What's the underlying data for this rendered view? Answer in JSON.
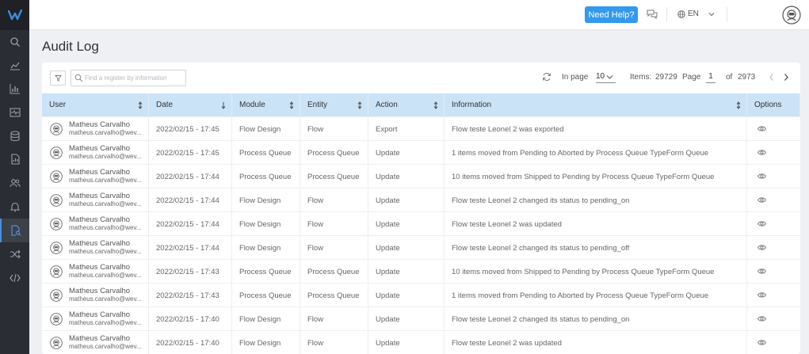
{
  "header": {
    "help_label": "Need Help?",
    "lang_label": "EN"
  },
  "page": {
    "title": "Audit Log"
  },
  "toolbar": {
    "search_placeholder": "Find a register by information",
    "in_page_label": "In page",
    "in_page_value": "10",
    "items_label": "Items:",
    "items_value": "29729",
    "page_label": "Page",
    "page_value": "1",
    "of_label": "of",
    "total_pages": "2973"
  },
  "columns": [
    "User",
    "Date",
    "Module",
    "Entity",
    "Action",
    "Information",
    "Options"
  ],
  "rows": [
    {
      "name": "Matheus Carvalho",
      "email": "matheus.carvalho@wev...",
      "date": "2022/02/15 - 17:45",
      "module": "Flow Design",
      "entity": "Flow",
      "action": "Export",
      "info": "Flow teste Leonel 2 was exported"
    },
    {
      "name": "Matheus Carvalho",
      "email": "matheus.carvalho@wev...",
      "date": "2022/02/15 - 17:45",
      "module": "Process Queue",
      "entity": "Process Queue",
      "action": "Update",
      "info": "1 items moved from Pending to Aborted by Process Queue TypeForm Queue"
    },
    {
      "name": "Matheus Carvalho",
      "email": "matheus.carvalho@wev...",
      "date": "2022/02/15 - 17:44",
      "module": "Process Queue",
      "entity": "Process Queue",
      "action": "Update",
      "info": "10 items moved from Shipped to Pending by Process Queue TypeForm Queue"
    },
    {
      "name": "Matheus Carvalho",
      "email": "matheus.carvalho@wev...",
      "date": "2022/02/15 - 17:44",
      "module": "Flow Design",
      "entity": "Flow",
      "action": "Update",
      "info": "Flow teste Leonel 2 changed its status to pending_on"
    },
    {
      "name": "Matheus Carvalho",
      "email": "matheus.carvalho@wev...",
      "date": "2022/02/15 - 17:44",
      "module": "Flow Design",
      "entity": "Flow",
      "action": "Update",
      "info": "Flow teste Leonel 2 was updated"
    },
    {
      "name": "Matheus Carvalho",
      "email": "matheus.carvalho@wev...",
      "date": "2022/02/15 - 17:44",
      "module": "Flow Design",
      "entity": "Flow",
      "action": "Update",
      "info": "Flow teste Leonel 2 changed its status to pending_off"
    },
    {
      "name": "Matheus Carvalho",
      "email": "matheus.carvalho@wev...",
      "date": "2022/02/15 - 17:43",
      "module": "Process Queue",
      "entity": "Process Queue",
      "action": "Update",
      "info": "10 items moved from Shipped to Pending by Process Queue TypeForm Queue"
    },
    {
      "name": "Matheus Carvalho",
      "email": "matheus.carvalho@wev...",
      "date": "2022/02/15 - 17:43",
      "module": "Process Queue",
      "entity": "Process Queue",
      "action": "Update",
      "info": "1 items moved from Pending to Aborted by Process Queue TypeForm Queue"
    },
    {
      "name": "Matheus Carvalho",
      "email": "matheus.carvalho@wev...",
      "date": "2022/02/15 - 17:40",
      "module": "Flow Design",
      "entity": "Flow",
      "action": "Update",
      "info": "Flow teste Leonel 2 changed its status to pending_on"
    },
    {
      "name": "Matheus Carvalho",
      "email": "matheus.carvalho@wev...",
      "date": "2022/02/15 - 17:40",
      "module": "Flow Design",
      "entity": "Flow",
      "action": "Update",
      "info": "Flow teste Leonel 2 was updated"
    }
  ],
  "sidebar": {
    "icons": [
      "search-icon",
      "trend-icon",
      "bar-chart-icon",
      "monitor-icon",
      "database-icon",
      "report-icon",
      "users-icon",
      "bell-icon",
      "audit-icon",
      "shuffle-icon",
      "code-icon"
    ],
    "active": "audit-icon"
  },
  "colors": {
    "accent": "#3399ee",
    "sidebar": "#2a2d33",
    "header_row": "#cbe3f7",
    "logo": "#3f8be0"
  }
}
